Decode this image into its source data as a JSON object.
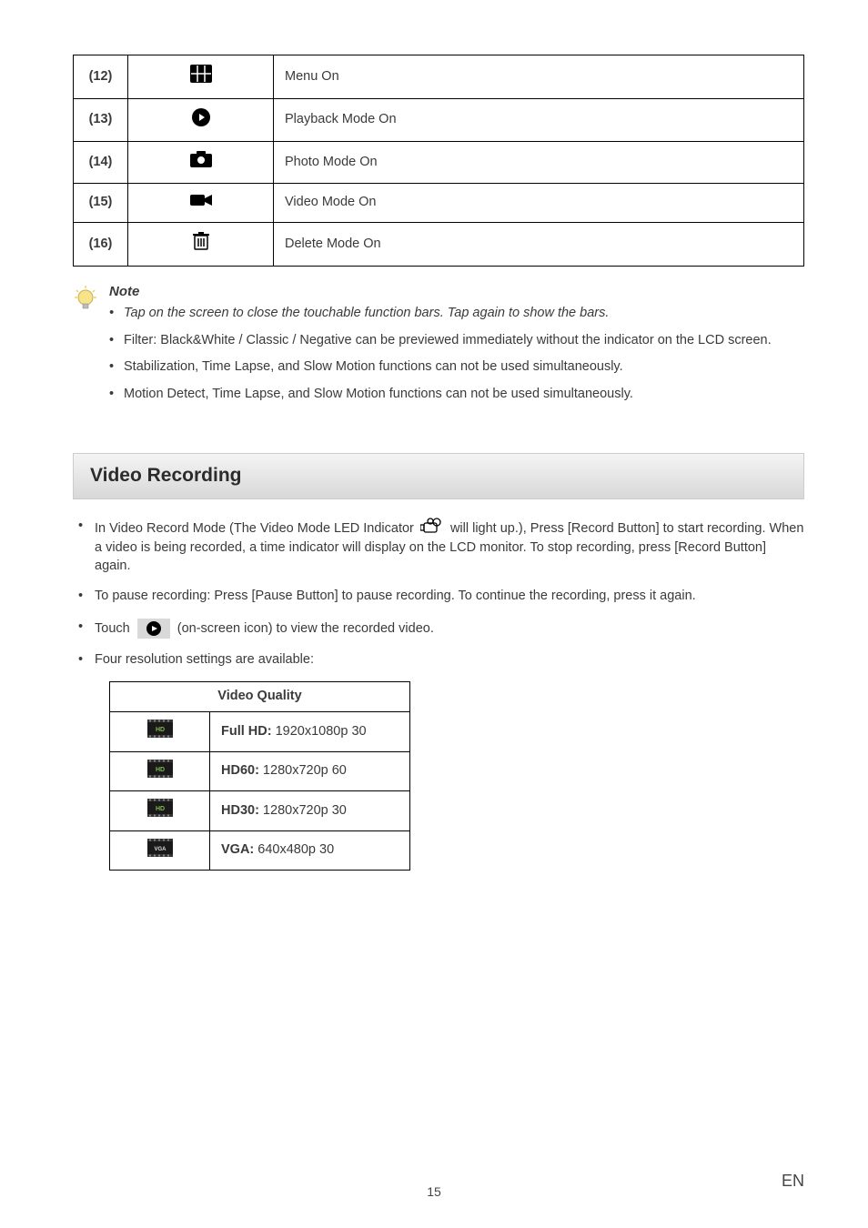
{
  "modes_table": [
    {
      "num": "(12)",
      "desc": "Menu On"
    },
    {
      "num": "(13)",
      "desc": "Playback Mode On"
    },
    {
      "num": "(14)",
      "desc": "Photo Mode On"
    },
    {
      "num": "(15)",
      "desc": "Video Mode On"
    },
    {
      "num": "(16)",
      "desc": "Delete Mode On"
    }
  ],
  "note": {
    "title": "Note",
    "items": [
      "Tap on the screen to close the touchable function bars. Tap again to show the bars.",
      "Filter: Black&White / Classic / Negative can be previewed immediately without the indicator on the LCD screen.",
      "Stabilization, Time Lapse, and Slow Motion functions can not be used simultaneously.",
      "Motion Detect, Time Lapse, and Slow Motion functions can not be used simultaneously."
    ]
  },
  "section_heading": "Video Recording",
  "body": {
    "b1_a": "In Video Record Mode (The Video Mode LED Indicator ",
    "b1_b": " will light up.), Press [Record Button] to start recording. When a video is being recorded, a time indicator will display on the LCD monitor. To stop recording, press [Record Button] again.",
    "b2": "To pause recording: Press [Pause Button] to pause recording. To continue the recording, press it again.",
    "b3_a": "Touch ",
    "b3_b": " (on-screen icon) to view the recorded video.",
    "b4": "Four resolution settings are available:"
  },
  "quality": {
    "header": "Video Quality",
    "rows": [
      {
        "bold": "Full HD:",
        "rest": " 1920x1080p 30"
      },
      {
        "bold": "HD60:",
        "rest": " 1280x720p 60"
      },
      {
        "bold": "HD30:",
        "rest": " 1280x720p 30"
      },
      {
        "bold": "VGA:",
        "rest": " 640x480p 30"
      }
    ]
  },
  "page_number": "15",
  "lang_label": "EN"
}
